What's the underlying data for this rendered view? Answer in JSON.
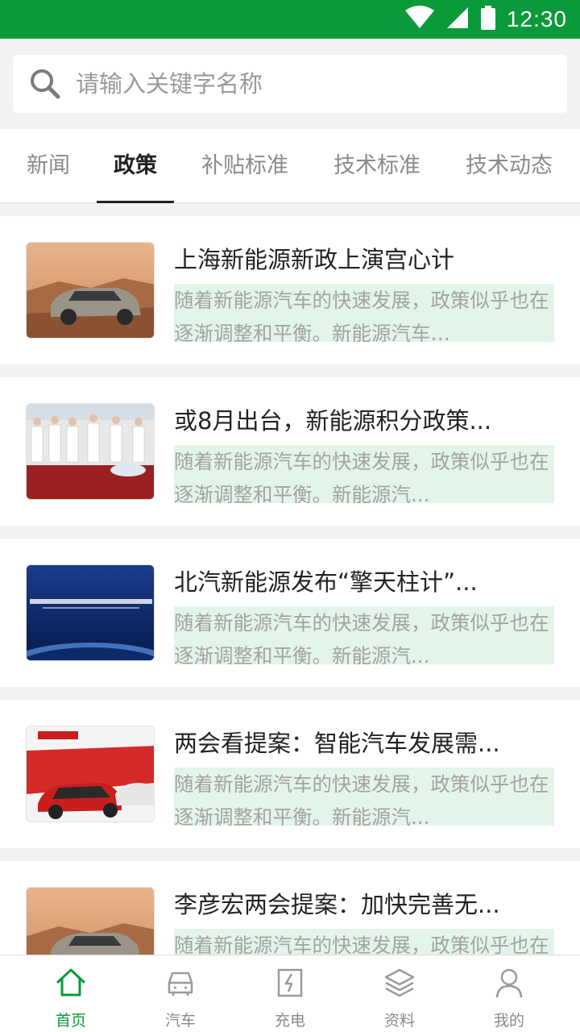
{
  "status_bar": {
    "time": "12:30",
    "icons": [
      "wifi-icon",
      "cellular-icon",
      "battery-icon"
    ]
  },
  "search": {
    "placeholder": "请输入关键字名称",
    "value": ""
  },
  "tabs": [
    {
      "label": "新闻",
      "active": false
    },
    {
      "label": "政策",
      "active": true
    },
    {
      "label": "补贴标准",
      "active": false
    },
    {
      "label": "技术标准",
      "active": false
    },
    {
      "label": "技术动态",
      "active": false
    }
  ],
  "articles": [
    {
      "title": "上海新能源新政上演宫心计",
      "summary": "随着新能源汽车的快速发展，政策似乎也在逐渐调整和平衡。新能源汽车…",
      "thumb": "suv-desert-image"
    },
    {
      "title": "或8月出台，新能源积分政策...",
      "summary": "随着新能源汽车的快速发展，政策似乎也在逐渐调整和平衡。新能源汽...",
      "thumb": "signing-ceremony-image"
    },
    {
      "title": "北汽新能源发布“擎天柱计”...",
      "summary": "随着新能源汽车的快速发展，政策似乎也在逐渐调整和平衡。新能源汽...",
      "thumb": "conference-banner-image"
    },
    {
      "title": "两会看提案：智能汽车发展需...",
      "summary": "随着新能源汽车的快速发展，政策似乎也在逐渐调整和平衡。新能源汽...",
      "thumb": "red-suv-511-image"
    },
    {
      "title": "李彦宏两会提案：加快完善无...",
      "summary": "随着新能源汽车的快速发展，政策似乎也在逐渐调整和平衡。新能源汽...",
      "thumb": "suv-desert-image"
    }
  ],
  "bottom_nav": [
    {
      "label": "首页",
      "icon": "home-icon",
      "active": true
    },
    {
      "label": "汽车",
      "icon": "car-icon",
      "active": false
    },
    {
      "label": "充电",
      "icon": "charging-icon",
      "active": false
    },
    {
      "label": "资料",
      "icon": "layers-icon",
      "active": false
    },
    {
      "label": "我的",
      "icon": "user-icon",
      "active": false
    }
  ],
  "colors": {
    "primary": "#0a9a3a",
    "summary_bg": "#e3f4e8",
    "inactive": "#8a8a8a"
  }
}
